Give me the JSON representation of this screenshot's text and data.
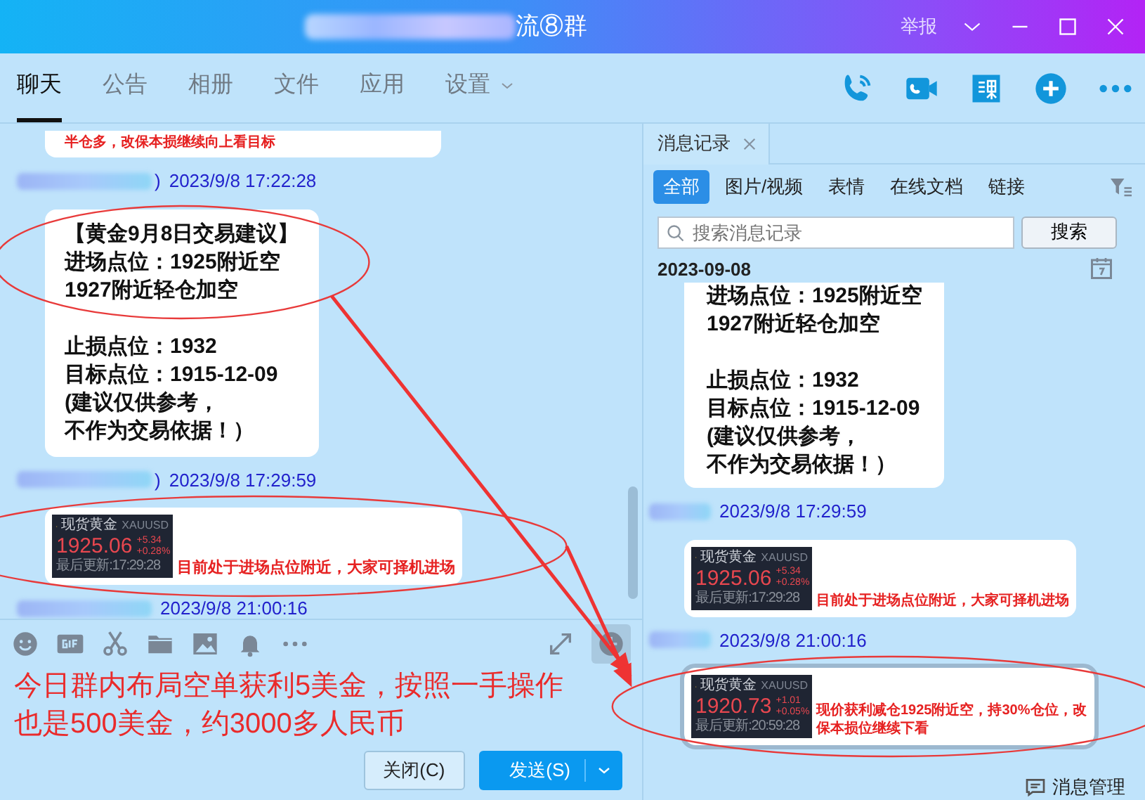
{
  "window": {
    "title": "流⑧群",
    "actions": [
      "举报"
    ]
  },
  "tabs": [
    {
      "label": "聊天",
      "selected": true,
      "has_menu": false
    },
    {
      "label": "公告",
      "selected": false,
      "has_menu": false
    },
    {
      "label": "相册",
      "selected": false,
      "has_menu": false
    },
    {
      "label": "文件",
      "selected": false,
      "has_menu": false
    },
    {
      "label": "应用",
      "selected": false,
      "has_menu": false
    },
    {
      "label": "设置",
      "selected": false,
      "has_menu": true
    }
  ],
  "chat": {
    "messages": [
      {
        "kind": "note",
        "text": "半仓多，改保本损继续向上看目标"
      },
      {
        "kind": "text",
        "sender_suffix": ")",
        "time": "2023/9/8 17:22:28",
        "paragraphs": [
          [
            "【黄金9月8日交易建议】",
            "进场点位：1925附近空",
            "1927附近轻仓加空"
          ],
          [
            "止损点位：1932",
            "目标点位：1915-12-09",
            "(建议仅供参考，",
            "不作为交易依据！）"
          ]
        ]
      },
      {
        "kind": "quote",
        "sender_suffix": ")",
        "time": "2023/9/8 17:29:59",
        "quote": {
          "name": "现货黄金",
          "symbol": "XAUUSD",
          "price": "1925.06",
          "change": "+5.34",
          "percent": "+0.28%",
          "updated": "最后更新:17:29:28"
        },
        "text": "目前处于进场点位附近，大家可择机进场"
      },
      {
        "kind": "header",
        "time": "2023/9/8 21:00:16"
      }
    ]
  },
  "composer": {
    "text": "今日群内布局空单获利5美金，按照一手操作也是500美金，约3000多人民币",
    "buttons": [
      {
        "label": "关闭(C)",
        "kind": "secondary"
      },
      {
        "label": "发送(S)",
        "kind": "primary"
      }
    ]
  },
  "history": {
    "tab": "消息记录",
    "filters": [
      {
        "label": "全部",
        "selected": true
      },
      {
        "label": "图片/视频",
        "selected": false
      },
      {
        "label": "表情",
        "selected": false
      },
      {
        "label": "在线文档",
        "selected": false
      },
      {
        "label": "链接",
        "selected": false
      }
    ],
    "search": {
      "placeholder": "搜索消息记录",
      "button": "搜索"
    },
    "date": "2023-09-08",
    "messages": [
      {
        "kind": "text",
        "selected": false,
        "paragraphs": [
          [
            "进场点位：1925附近空",
            "1927附近轻仓加空"
          ],
          [
            "止损点位：1932",
            "目标点位：1915-12-09",
            "(建议仅供参考，",
            "不作为交易依据！）"
          ]
        ]
      },
      {
        "kind": "quote",
        "selected": false,
        "time": "2023/9/8 17:29:59",
        "quote": {
          "name": "现货黄金",
          "symbol": "XAUUSD",
          "price": "1925.06",
          "change": "+5.34",
          "percent": "+0.28%",
          "updated": "最后更新:17:29:28"
        },
        "text": "目前处于进场点位附近，大家可择机进场"
      },
      {
        "kind": "quote",
        "selected": true,
        "time": "2023/9/8 21:00:16",
        "quote": {
          "name": "现货黄金",
          "symbol": "XAUUSD",
          "price": "1920.73",
          "change": "+1.01",
          "percent": "+0.05%",
          "updated": "最后更新:20:59:28"
        },
        "text": "现价获利减仓1925附近空，持30%仓位，改保本损位继续下看"
      }
    ],
    "footer": "消息管理"
  }
}
